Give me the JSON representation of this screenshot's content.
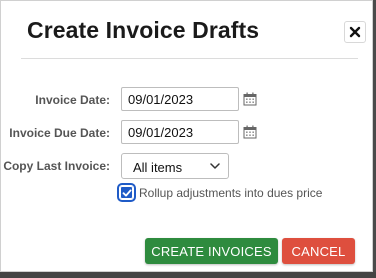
{
  "dialog": {
    "title": "Create Invoice Drafts",
    "close_symbol": "✕"
  },
  "form": {
    "invoice_date": {
      "label": "Invoice Date:",
      "value": "09/01/2023"
    },
    "invoice_due_date": {
      "label": "Invoice Due Date:",
      "value": "09/01/2023"
    },
    "copy_last_invoice": {
      "label": "Copy Last Invoice:",
      "selected": "All items"
    },
    "rollup": {
      "label": "Rollup adjustments into dues price",
      "checked": true
    }
  },
  "actions": {
    "create_label": "CREATE INVOICES",
    "cancel_label": "CANCEL"
  },
  "colors": {
    "create_button": "#2e8b3e",
    "cancel_button": "#de4f3e",
    "checkbox_accent": "#1f5bc7"
  },
  "icons": {
    "close": "close-icon",
    "calendar": "calendar-icon",
    "dropdown": "chevron-down-icon",
    "check": "checkmark-icon"
  }
}
